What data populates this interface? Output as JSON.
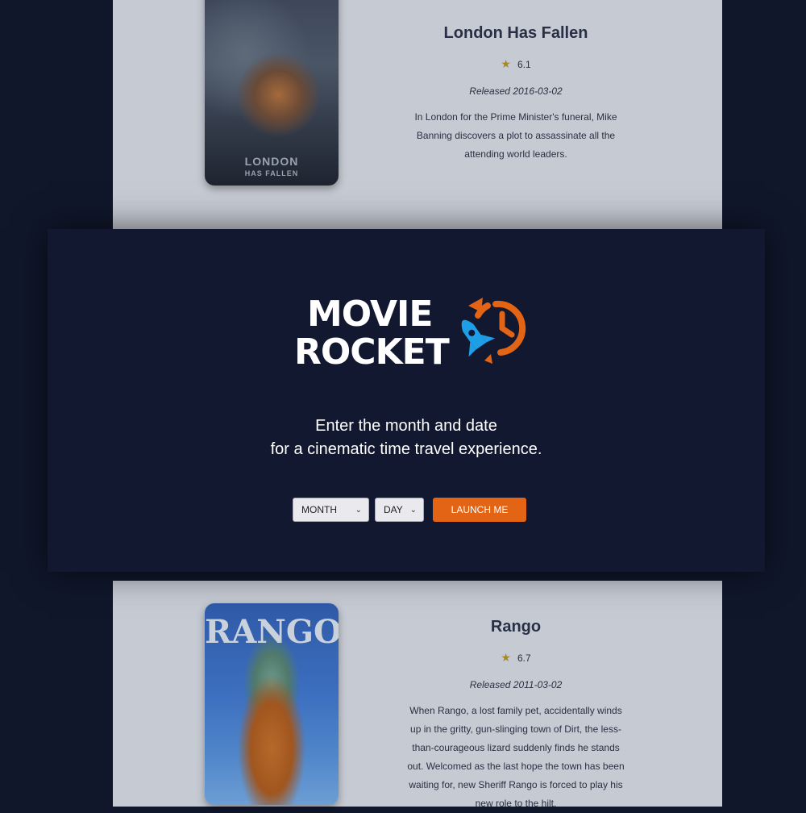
{
  "movies": [
    {
      "title": "London Has Fallen",
      "rating": "6.1",
      "release": "Released 2016-03-02",
      "overview": "In London for the Prime Minister's funeral, Mike Banning discovers a plot to assassinate all the attending world leaders.",
      "poster_text_line1": "LONDON",
      "poster_text_line2": "HAS FALLEN"
    },
    {
      "title": "Rango",
      "rating": "6.7",
      "release": "Released 2011-03-02",
      "overview": "When Rango, a lost family pet, accidentally winds up in the gritty, gun-slinging town of Dirt, the less-than-courageous lizard suddenly finds he stands out. Welcomed as the last hope the town has been waiting for, new Sheriff Rango is forced to play his new role to the hilt.",
      "poster_text": "RANGO"
    }
  ],
  "modal": {
    "logo_line1": "MOVIE",
    "logo_line2": "ROCKET",
    "tagline_line1": "Enter the month and date",
    "tagline_line2": "for a cinematic time travel experience.",
    "month_select": "MONTH",
    "day_select": "DAY",
    "launch_button": "LAUNCH ME"
  },
  "colors": {
    "background": "#10172b",
    "accent": "#e36414",
    "rocket": "#1f9ee8",
    "star": "#a88921"
  },
  "icons": {
    "rating": "star-icon",
    "logo": "rocket-clock-icon",
    "select": "chevron-down-icon"
  }
}
